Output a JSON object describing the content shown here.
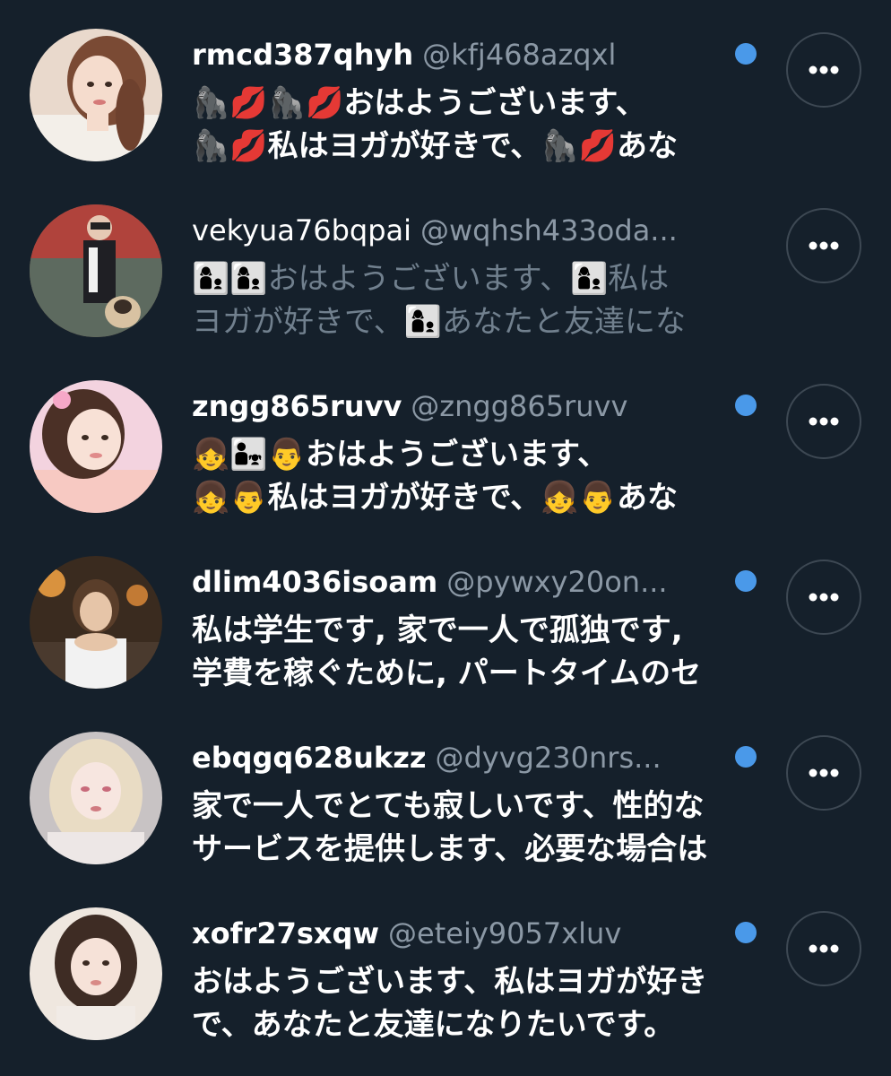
{
  "accounts": [
    {
      "display_name": "rmcd387qhyh",
      "handle": "@kfj468azqxl",
      "unread": true,
      "avatar_icon": "user-photo-avatar",
      "bio_lines": [
        "🦍💋🦍💋おはようございます、",
        "🦍💋私はヨガが好きで、🦍💋あな"
      ]
    },
    {
      "display_name": "vekyua76bqpai",
      "handle": "@wqhsh433oda...",
      "unread": false,
      "avatar_icon": "user-photo-avatar",
      "bio_lines": [
        "👩‍👦👩‍👦おはようございます、👩‍👦私は",
        "ヨガが好きで、👩‍👦あなたと友達にな"
      ]
    },
    {
      "display_name": "zngg865ruvv",
      "handle": "@zngg865ruvv",
      "unread": true,
      "avatar_icon": "user-photo-avatar",
      "bio_lines": [
        "👧👨‍👧👨おはようございます、",
        "👧👨私はヨガが好きで、👧👨あな"
      ]
    },
    {
      "display_name": "dlim4036isoam",
      "handle": "@pywxy20on...",
      "unread": true,
      "avatar_icon": "user-photo-avatar",
      "bio_lines": [
        "私は学生です, 家で一人で孤独です,",
        "学費を稼ぐために, パートタイムのセ"
      ]
    },
    {
      "display_name": "ebqgq628ukzz",
      "handle": "@dyvg230nrs...",
      "unread": true,
      "avatar_icon": "user-photo-avatar",
      "bio_lines": [
        "家で一人でとても寂しいです、性的な",
        "サービスを提供します、必要な場合は"
      ]
    },
    {
      "display_name": "xofr27sxqw",
      "handle": "@eteiy9057xluv",
      "unread": true,
      "avatar_icon": "user-photo-avatar",
      "bio_lines": [
        "おはようございます、私はヨガが好き",
        "で、あなたと友達になりたいです。"
      ]
    }
  ],
  "more_icon": "more-horizontal-icon",
  "colors": {
    "background": "#15202b",
    "unread_dot": "#4a99e9",
    "handle": "#8b98a5",
    "read_bio": "#71808e",
    "button_border": "#3d4853"
  }
}
